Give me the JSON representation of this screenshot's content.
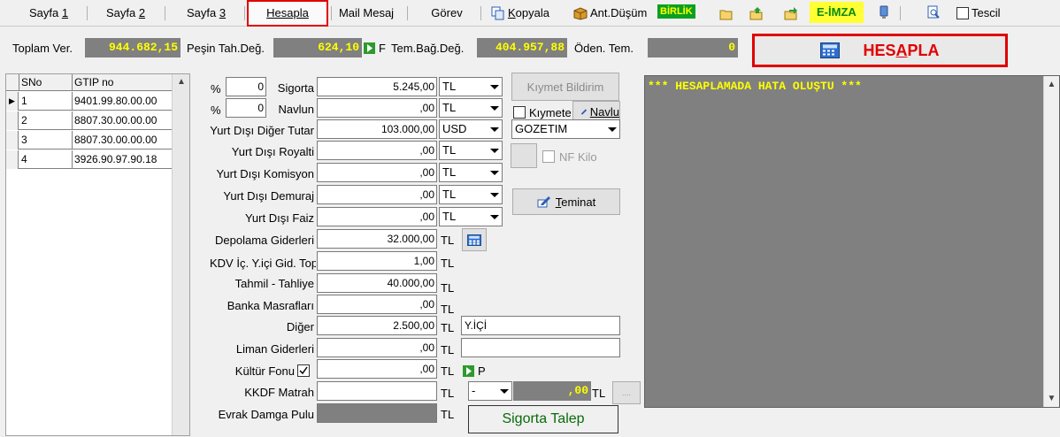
{
  "tabs": [
    {
      "label_pre": "Sayfa ",
      "label_ul": "1"
    },
    {
      "label_pre": "Sayfa ",
      "label_ul": "2"
    },
    {
      "label_pre": "Sayfa ",
      "label_ul": "3"
    },
    {
      "label_pre": "",
      "label_ul": "Hesapla"
    },
    {
      "label_pre": "Mail Mesaj",
      "label_ul": ""
    },
    {
      "label_pre": "Görev",
      "label_ul": ""
    }
  ],
  "toolbar": {
    "kopyala_ul": "K",
    "kopyala_rest": "opyala",
    "ant_dusum": "Ant.Düşüm",
    "birlik": "BİRLİK",
    "e_imza": "E-İMZA",
    "tescil": "Tescil"
  },
  "totals": {
    "toplam_ver_label": "Toplam Ver.",
    "toplam_ver_value": "944.682,15",
    "pesin_label": "Peşin Tah.Değ.",
    "pesin_value": "624,10",
    "f_label": "F",
    "tem_bag_label": "Tem.Bağ.Değ.",
    "tem_bag_value": "404.957,88",
    "oden_tem_label": "Öden. Tem.",
    "oden_tem_value": "0",
    "hesapla_pre": "HES",
    "hesapla_ul": "A",
    "hesapla_post": "PLA"
  },
  "grid": {
    "columns": [
      "SNo",
      "GTIP no"
    ],
    "rows": [
      {
        "sno": "1",
        "gtip": "9401.99.80.00.00"
      },
      {
        "sno": "2",
        "gtip": "8807.30.00.00.00"
      },
      {
        "sno": "3",
        "gtip": "8807.30.00.00.00"
      },
      {
        "sno": "4",
        "gtip": "3926.90.97.90.18"
      }
    ]
  },
  "form": {
    "pct_sym": "%",
    "sigorta_pct": "0",
    "navlun_pct": "0",
    "fields": [
      {
        "label": "Sigorta",
        "value": "5.245,00",
        "unit": "TL"
      },
      {
        "label": "Navlun",
        "value": ",00",
        "unit": "TL"
      },
      {
        "label": "Yurt Dışı Diğer Tutar",
        "value": "103.000,00",
        "unit": "USD"
      },
      {
        "label": "Yurt Dışı Royalti",
        "value": ",00",
        "unit": "TL"
      },
      {
        "label": "Yurt Dışı Komisyon",
        "value": ",00",
        "unit": "TL"
      },
      {
        "label": "Yurt Dışı Demuraj",
        "value": ",00",
        "unit": "TL"
      },
      {
        "label": "Yurt Dışı Faiz",
        "value": ",00",
        "unit": "TL"
      },
      {
        "label": "Depolama Giderleri",
        "value": "32.000,00",
        "unit": "TL"
      },
      {
        "label": "KDV İç. Y.içi Gid. Top",
        "value": "1,00",
        "unit": "TL"
      },
      {
        "label": "Tahmil - Tahliye",
        "value": "40.000,00",
        "unit": "TL"
      },
      {
        "label": "Banka Masrafları",
        "value": ",00",
        "unit": "TL"
      },
      {
        "label": "Diğer",
        "value": "2.500,00",
        "unit": "TL",
        "note": "Y.İÇİ"
      },
      {
        "label": "Liman Giderleri",
        "value": ",00",
        "unit": "TL",
        "note": ""
      },
      {
        "label": "Kültür Fonu",
        "value": ",00",
        "unit": "TL",
        "p": "P"
      },
      {
        "label": "KKDF Matrah",
        "value": "",
        "unit": "TL",
        "select": "-",
        "gray_value": ",00",
        "gray_unit": "TL",
        "btn": "...."
      },
      {
        "label": "Evrak Damga Pulu",
        "value": "",
        "unit": "TL"
      }
    ],
    "kiymet_bildirim": "Kıymet Bildirim",
    "kiymete_label": "Kıymete",
    "navlu_label": "Navlu",
    "gozetim": "GOZETIM",
    "nf_kilo": "NF Kilo",
    "teminat_ul": "T",
    "teminat_rest": "eminat",
    "sigorta_talep": "Sigorta Talep"
  },
  "result": {
    "message": "*** HESAPLAMADA HATA OLUŞTU ***"
  },
  "colors": {
    "accent_red": "#e00000",
    "value_yellow": "#ffff00",
    "panel_gray": "#808080"
  }
}
